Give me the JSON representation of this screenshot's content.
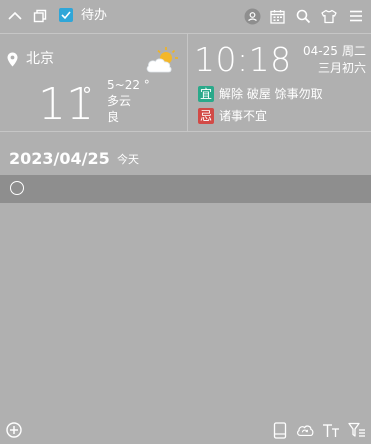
{
  "toolbar": {
    "todo_label": "待办",
    "icons": [
      "collapse-icon",
      "restore-icon",
      "todo-check-icon",
      "user-icon",
      "calendar-icon",
      "search-icon",
      "skin-icon",
      "menu-icon"
    ]
  },
  "weather": {
    "city": "北京",
    "temperature": "11",
    "degree_symbol": "°",
    "range": "5~22 °",
    "condition": "多云",
    "air_quality": "良"
  },
  "calendar": {
    "time": "10:18",
    "date": "04-25",
    "weekday": "周二",
    "lunar": "三月初六",
    "yi_label": "宜",
    "yi_text": "解除 破屋 馀事勿取",
    "ji_label": "忌",
    "ji_text": "诸事不宜"
  },
  "list": {
    "date": "2023/04/25",
    "today_label": "今天"
  },
  "bottombar": {
    "icons": [
      "add-icon",
      "tablet-icon",
      "cloud-sync-icon",
      "font-size-icon",
      "filter-icon"
    ]
  },
  "colors": {
    "background": "#b0b0b0",
    "task_row": "#8e8e8e",
    "check_blue": "#2fa6d8",
    "yi_green": "#2aa98a",
    "ji_red": "#d24a46"
  }
}
